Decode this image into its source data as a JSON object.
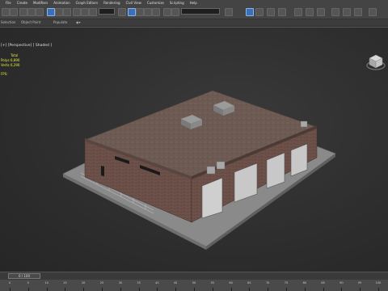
{
  "menu": [
    "File",
    "Create",
    "Modifiers",
    "Animation",
    "Graph Editors",
    "Rendering",
    "Civil View",
    "Customize",
    "Scripting",
    "Help"
  ],
  "ribbon": {
    "tab1": "Selection",
    "tab2": "Object Paint",
    "tab3": "Populate"
  },
  "viewport": {
    "label": "[+] [Perspective] [ Shaded ]",
    "stats_header": "Total",
    "stats": [
      {
        "label": "Polys:",
        "value": "6,890"
      },
      {
        "label": "Verts:",
        "value": "6,290"
      }
    ],
    "fps_label": "FPS:"
  },
  "timeline": {
    "frame_display": "0 / 100"
  },
  "trackbar": {
    "ticks": [
      "0",
      "5",
      "10",
      "15",
      "20",
      "25",
      "30",
      "35",
      "40",
      "45",
      "50",
      "55",
      "60",
      "65",
      "70",
      "75",
      "80",
      "85",
      "90",
      "95",
      "100"
    ]
  },
  "colors": {
    "ui_bg": "#444444",
    "viewport_bg": "#2e2e2e",
    "stats_yellow": "#e8e840",
    "brick": "#6b5048",
    "roof": "#6a5750",
    "ground": "#8a8a8a"
  }
}
